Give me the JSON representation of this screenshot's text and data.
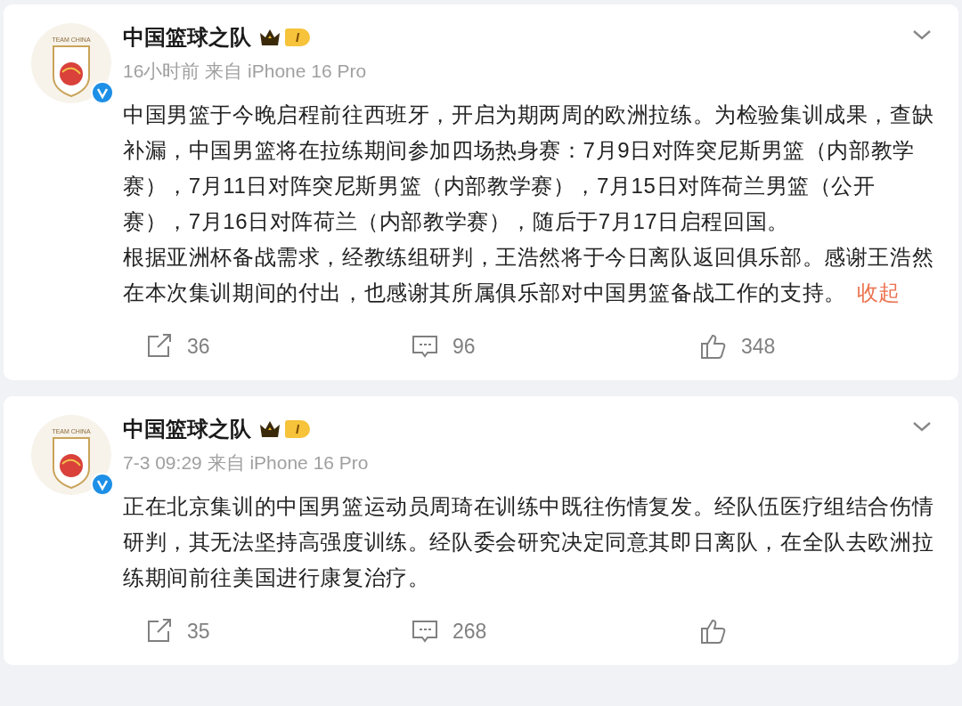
{
  "posts": [
    {
      "author": "中国篮球之队",
      "avatar_label": "TEAM CHINA",
      "level_badge": "I",
      "verified": true,
      "meta": "16小时前 来自 iPhone 16 Pro",
      "paragraphs": [
        "中国男篮于今晚启程前往西班牙，开启为期两周的欧洲拉练。为检验集训成果，查缺补漏，中国男篮将在拉练期间参加四场热身赛：7月9日对阵突尼斯男篮（内部教学赛），7月11日对阵突尼斯男篮（内部教学赛），7月15日对阵荷兰男篮（公开赛），7月16日对阵荷兰（内部教学赛），随后于7月17日启程回国。",
        "根据亚洲杯备战需求，经教练组研判，王浩然将于今日离队返回俱乐部。感谢王浩然在本次集训期间的付出，也感谢其所属俱乐部对中国男篮备战工作的支持。"
      ],
      "collapse_link": "收起",
      "actions": [
        {
          "kind": "repost",
          "count": "36"
        },
        {
          "kind": "comment",
          "count": "96"
        },
        {
          "kind": "like",
          "count": "348"
        }
      ]
    },
    {
      "author": "中国篮球之队",
      "avatar_label": "TEAM CHINA",
      "level_badge": "I",
      "verified": true,
      "meta": "7-3 09:29 来自 iPhone 16 Pro",
      "paragraphs": [
        "正在北京集训的中国男篮运动员周琦在训练中既往伤情复发。经队伍医疗组结合伤情研判，其无法坚持高强度训练。经队委会研究决定同意其即日离队，在全队去欧洲拉练期间前往美国进行康复治疗。"
      ],
      "actions": [
        {
          "kind": "repost",
          "count": "35"
        },
        {
          "kind": "comment",
          "count": "268"
        },
        {
          "kind": "like"
        }
      ]
    }
  ]
}
